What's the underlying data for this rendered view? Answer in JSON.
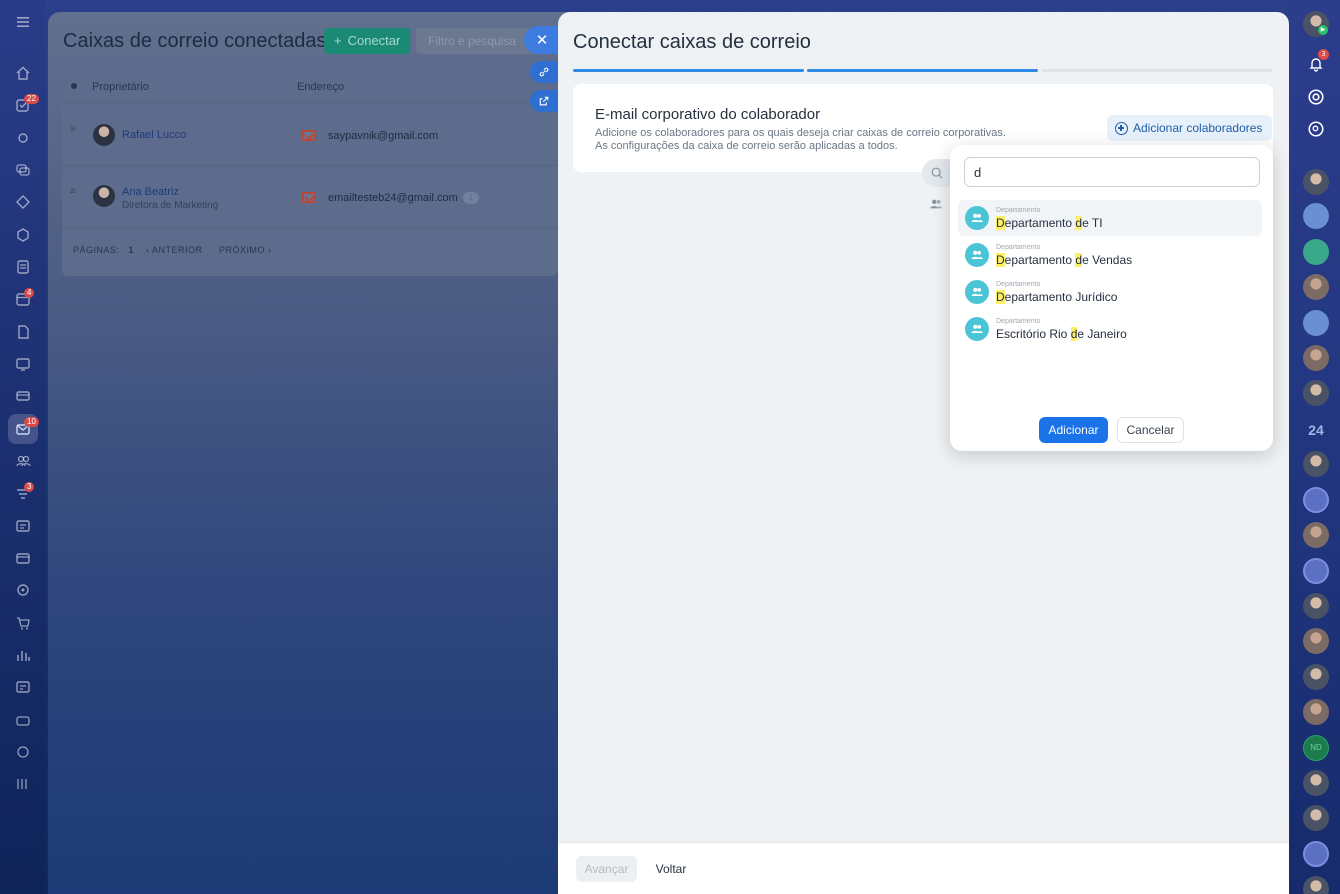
{
  "background_page": {
    "title": "Caixas de correio conectadas",
    "connect_label": "Conectar",
    "filter_placeholder": "Filtro e pesquisa",
    "columns": [
      "Proprietário",
      "Endereço"
    ],
    "rows": [
      {
        "owner": "Rafael Lucco",
        "role": "",
        "email": "saypavnik@gmail.com",
        "count": ""
      },
      {
        "owner": "Ana Beatriz",
        "role": "Diretora de Marketing",
        "email": "emailtesteb24@gmail.com",
        "count": "1"
      }
    ],
    "pager": {
      "pages_label": "PÁGINAS:",
      "current": "1",
      "prev": "ANTERIOR",
      "next": "PRÓXIMO"
    }
  },
  "left_rail_badges": {
    "tasks": "22",
    "calendar": "4",
    "mail": "10",
    "marketing": "3"
  },
  "panel": {
    "title": "Conectar caixas de correio",
    "steps": [
      {
        "state": "done",
        "color": "#2f8be6"
      },
      {
        "state": "active",
        "color": "#2f8be6"
      },
      {
        "state": "pending",
        "color": "#dfe4e8"
      }
    ],
    "card": {
      "title": "E-mail corporativo do colaborador",
      "description_line1": "Adicione os colaboradores para os quais deseja criar caixas de correio corporativas.",
      "description_line2": "As configurações da caixa de correio serão aplicadas a todos.",
      "add_button": "Adicionar colaboradores"
    },
    "footer": {
      "next": "Avançar",
      "back": "Voltar"
    }
  },
  "dropdown": {
    "search_value": "d",
    "results": [
      {
        "caption": "Departamento",
        "parts": [
          {
            "t": "D",
            "h": true
          },
          {
            "t": "epartamento ",
            "h": false
          },
          {
            "t": "d",
            "h": true
          },
          {
            "t": "e TI",
            "h": false
          }
        ]
      },
      {
        "caption": "Departamento",
        "parts": [
          {
            "t": "D",
            "h": true
          },
          {
            "t": "epartamento ",
            "h": false
          },
          {
            "t": "d",
            "h": true
          },
          {
            "t": "e Vendas",
            "h": false
          }
        ]
      },
      {
        "caption": "Departamento",
        "parts": [
          {
            "t": "D",
            "h": true
          },
          {
            "t": "epartamento Jurídico",
            "h": false
          }
        ]
      },
      {
        "caption": "Departamento",
        "parts": [
          {
            "t": "Escritório Rio ",
            "h": false
          },
          {
            "t": "d",
            "h": true
          },
          {
            "t": "e Janeiro",
            "h": false
          }
        ]
      }
    ],
    "add_label": "Adicionar",
    "cancel_label": "Cancelar"
  },
  "right_rail": {
    "notifications_count": "3",
    "badge_24": "24",
    "initials": "ND"
  },
  "colors": {
    "accent": "#1a73e8",
    "highlight": "#fff06a",
    "dept_avatar": "#4bc5d6",
    "connect_button": "#1a8a74"
  }
}
